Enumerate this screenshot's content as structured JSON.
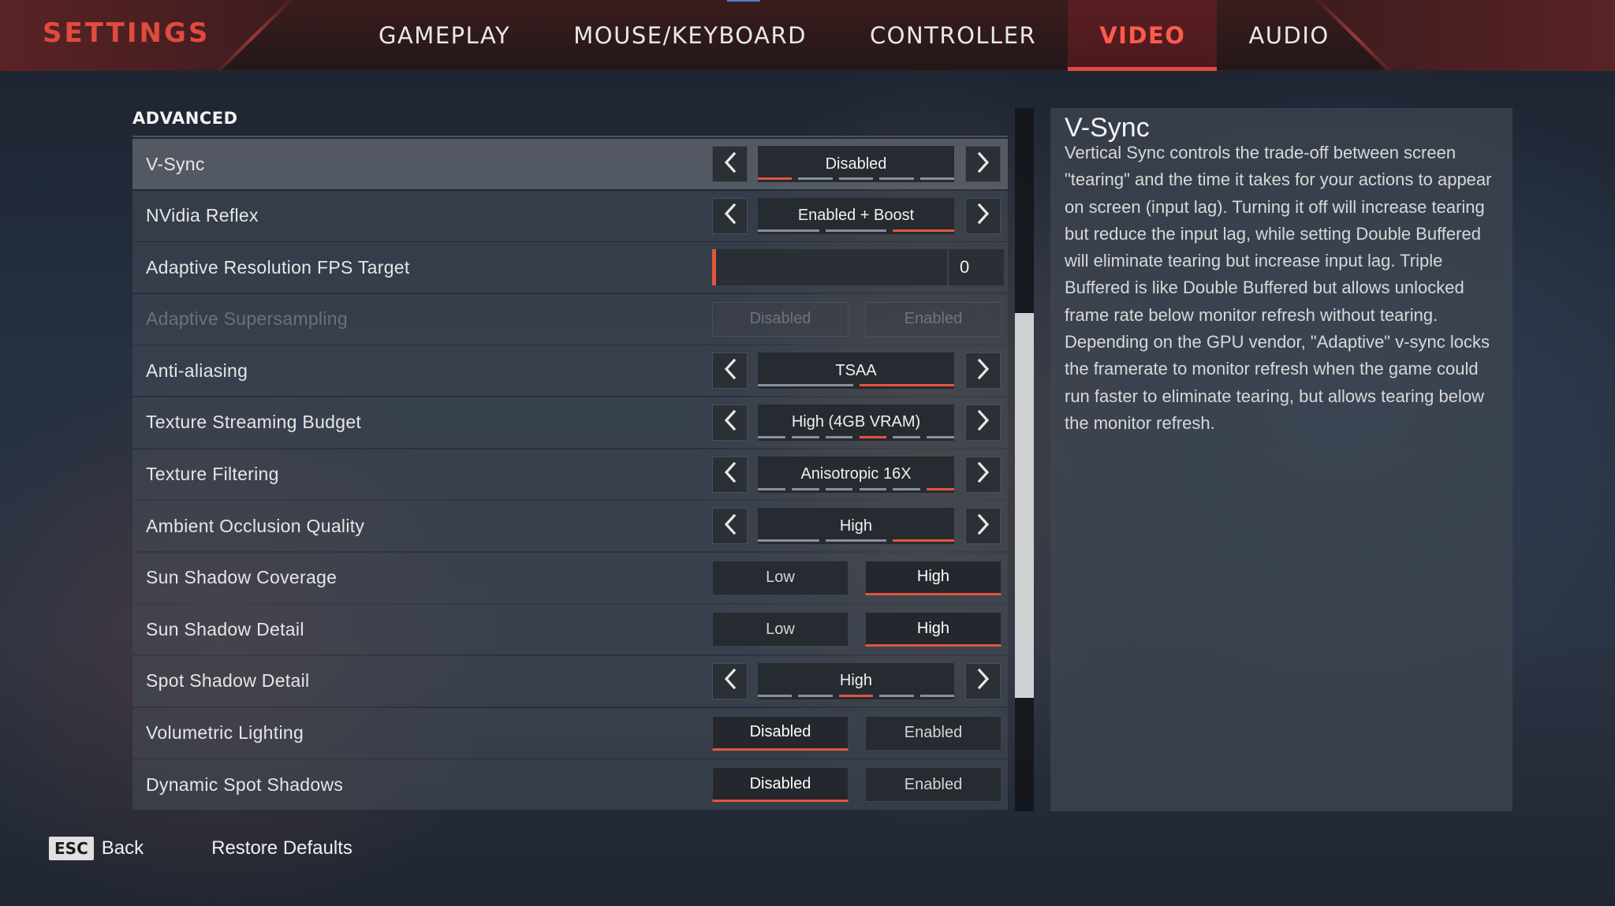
{
  "header": {
    "title": "SETTINGS",
    "tabs": [
      {
        "label": "GAMEPLAY",
        "active": false
      },
      {
        "label": "MOUSE/KEYBOARD",
        "active": false
      },
      {
        "label": "CONTROLLER",
        "active": false
      },
      {
        "label": "VIDEO",
        "active": true
      },
      {
        "label": "AUDIO",
        "active": false
      }
    ]
  },
  "section": {
    "heading": "ADVANCED"
  },
  "settings": [
    {
      "label": "V-Sync",
      "control": "cycler",
      "value": "Disabled",
      "options_count": 5,
      "selected_index": 0,
      "selected": true
    },
    {
      "label": "NVidia Reflex",
      "control": "cycler",
      "value": "Enabled + Boost",
      "options_count": 3,
      "selected_index": 2
    },
    {
      "label": "Adaptive Resolution FPS Target",
      "control": "slider",
      "value": "0",
      "fill_fraction": 0.0
    },
    {
      "label": "Adaptive Supersampling",
      "control": "toggle",
      "disabled": true,
      "options": [
        "Disabled",
        "Enabled"
      ],
      "selected_index": -1
    },
    {
      "label": "Anti-aliasing",
      "control": "cycler",
      "value": "TSAA",
      "options_count": 2,
      "selected_index": 1
    },
    {
      "label": "Texture Streaming Budget",
      "control": "cycler",
      "value": "High (4GB VRAM)",
      "options_count": 6,
      "selected_index": 3
    },
    {
      "label": "Texture Filtering",
      "control": "cycler",
      "value": "Anisotropic 16X",
      "options_count": 6,
      "selected_index": 5
    },
    {
      "label": "Ambient Occlusion Quality",
      "control": "cycler",
      "value": "High",
      "options_count": 3,
      "selected_index": 2
    },
    {
      "label": "Sun Shadow Coverage",
      "control": "toggle",
      "options": [
        "Low",
        "High"
      ],
      "selected_index": 1
    },
    {
      "label": "Sun Shadow Detail",
      "control": "toggle",
      "options": [
        "Low",
        "High"
      ],
      "selected_index": 1
    },
    {
      "label": "Spot Shadow Detail",
      "control": "cycler",
      "value": "High",
      "options_count": 5,
      "selected_index": 2
    },
    {
      "label": "Volumetric Lighting",
      "control": "toggle",
      "options": [
        "Disabled",
        "Enabled"
      ],
      "selected_index": 0
    },
    {
      "label": "Dynamic Spot Shadows",
      "control": "toggle",
      "options": [
        "Disabled",
        "Enabled"
      ],
      "selected_index": 0
    }
  ],
  "description": {
    "title": "V-Sync",
    "body": "Vertical Sync controls the trade-off between screen \"tearing\" and the time it takes for your actions to appear on screen (input lag). Turning it off will increase tearing but reduce the input lag, while setting Double Buffered will eliminate tearing but increase input lag. Triple Buffered is like Double Buffered but allows unlocked frame rate below monitor refresh without tearing. Depending on the GPU vendor, \"Adaptive\" v-sync locks the framerate to monitor refresh when the game could run faster to eliminate tearing, but allows tearing below the monitor refresh."
  },
  "footer": {
    "esc_key": "ESC",
    "back_label": "Back",
    "restore_label": "Restore Defaults"
  },
  "colors": {
    "accent": "#e2553d",
    "title_red": "#e04a3f"
  }
}
